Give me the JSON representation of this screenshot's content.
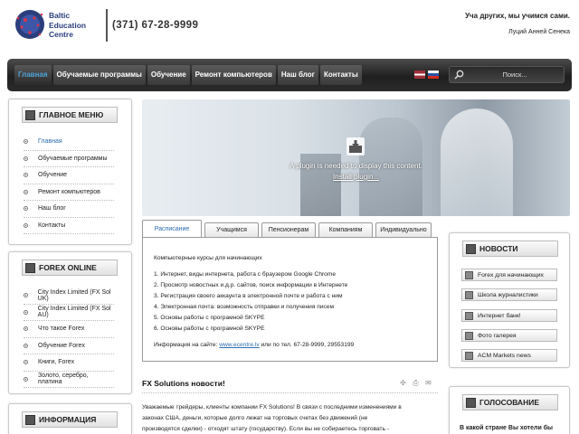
{
  "header": {
    "logo_lines": [
      "Baltic",
      "Education",
      "Centre"
    ],
    "phone": "(371) 67-28-9999",
    "quote": "Уча других, мы учимся сами.",
    "quote_author": "Луций Анней Сенека"
  },
  "nav": {
    "items": [
      {
        "label": "Главная",
        "active": true
      },
      {
        "label": "Обучаемые программы",
        "active": false
      },
      {
        "label": "Обучение",
        "active": false
      },
      {
        "label": "Ремонт компьютеров",
        "active": false
      },
      {
        "label": "Наш блог",
        "active": false
      },
      {
        "label": "Контакты",
        "active": false
      }
    ],
    "search_placeholder": "Поиск..."
  },
  "main_menu": {
    "title": "ГЛАВНОЕ МЕНЮ",
    "items": [
      "Главная",
      "Обучаемые программы",
      "Обучение",
      "Ремонт компьютеров",
      "Наш блог",
      "Контакты"
    ]
  },
  "forex_menu": {
    "title": "FOREX ONLINE",
    "items": [
      "City Index Limited (FX Sol UK)",
      "City Index Limited (FX Sol AU)",
      "Что такое Forex",
      "Обучение Forex",
      "Книги, Forex",
      "Золото, серебро, платина"
    ]
  },
  "info_panel": {
    "title": "ИНФОРМАЦИЯ"
  },
  "plugin": {
    "message": "A plugin is needed to display this content.",
    "link": "Install plugin..."
  },
  "tabs": {
    "items": [
      "Расписание",
      "Учащимся",
      "Пенсионерам",
      "Компаниям",
      "Индивидуально"
    ],
    "active_index": 0,
    "content": {
      "heading": "Компьютерные курсы для начинающих",
      "lines": [
        "1. Интернет, виды интернета, работа с браузером Google Chrome",
        "2. Просмотр новостных и.д.р. сайтов, поиск информации в Интернете",
        "3. Регистрация своего аккаунта в электронной почте и работа с ним",
        "4. Электронная почта: возможность отправки и получения писем",
        "5. Основы работы с програмной SKYPE",
        "6. Основы работы с програмной SKYPE"
      ],
      "info_prefix": "Информация на сайте: ",
      "info_link": "www.ecentre.lv",
      "info_suffix": " или по тел. 67-28-9999, 29553199"
    }
  },
  "news": {
    "title": "FX Solutions новости!",
    "lines": [
      "Уважаемые трейдеры, клиенты компании FX Solutions! В связи с последними изменениями в",
      "законах США, деньги, которые долго лежат на торговых счетах без движений (не",
      "производятся сделки) - отходят штату (государству). Если вы не собираетесь торговать -"
    ]
  },
  "news_panel": {
    "title": "НОВОСТИ",
    "items": [
      "Forex для начинающих",
      "Школа журналистики",
      "Интернет банк!",
      "Фото галерея",
      "ACM Markets news"
    ]
  },
  "vote_panel": {
    "title": "ГОЛОСОВАНИЕ",
    "question": "В какой стране Вы хотели бы"
  },
  "colors": {
    "accent": "#2b6cb0",
    "nav_active": "#4fa3d9",
    "nav_bg": "#2c2c2c"
  }
}
